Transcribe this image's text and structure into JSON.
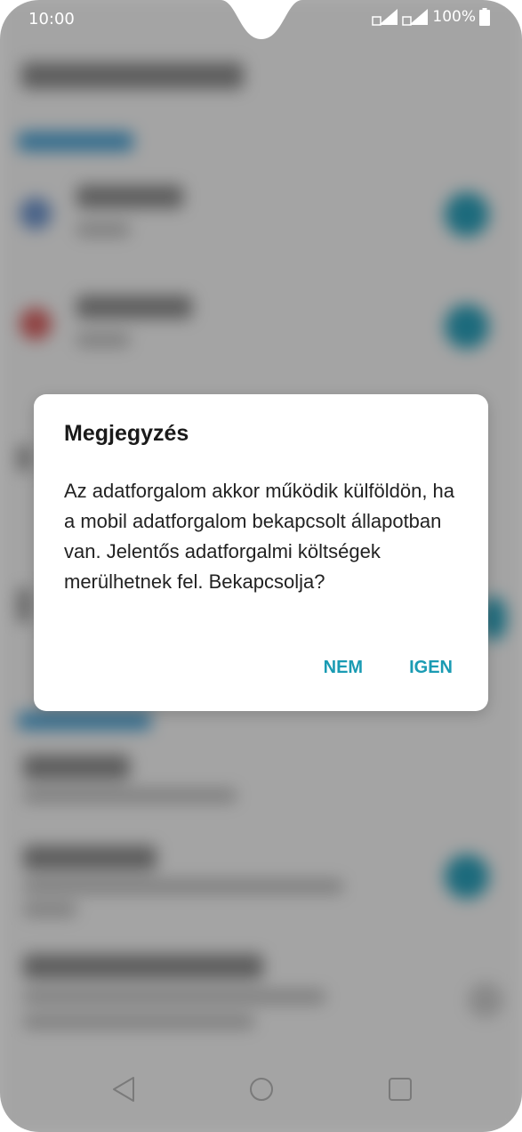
{
  "status_bar": {
    "time": "10:00",
    "battery": "100%"
  },
  "dialog": {
    "title": "Megjegyzés",
    "message": "Az adatforgalom akkor működik külföldön, ha a mobil adatforgalom bekapcsolt állapotban van. Jelentős adatforgalmi költségek merülhetnek fel. Bekapcsolja?",
    "negative_label": "NEM",
    "positive_label": "IGEN"
  },
  "colors": {
    "accent": "#1a9bb3",
    "scrim": "#7f7f7f"
  },
  "icons": {
    "nav_back": "back-triangle-icon",
    "nav_home": "home-circle-icon",
    "nav_recents": "recents-square-icon"
  }
}
